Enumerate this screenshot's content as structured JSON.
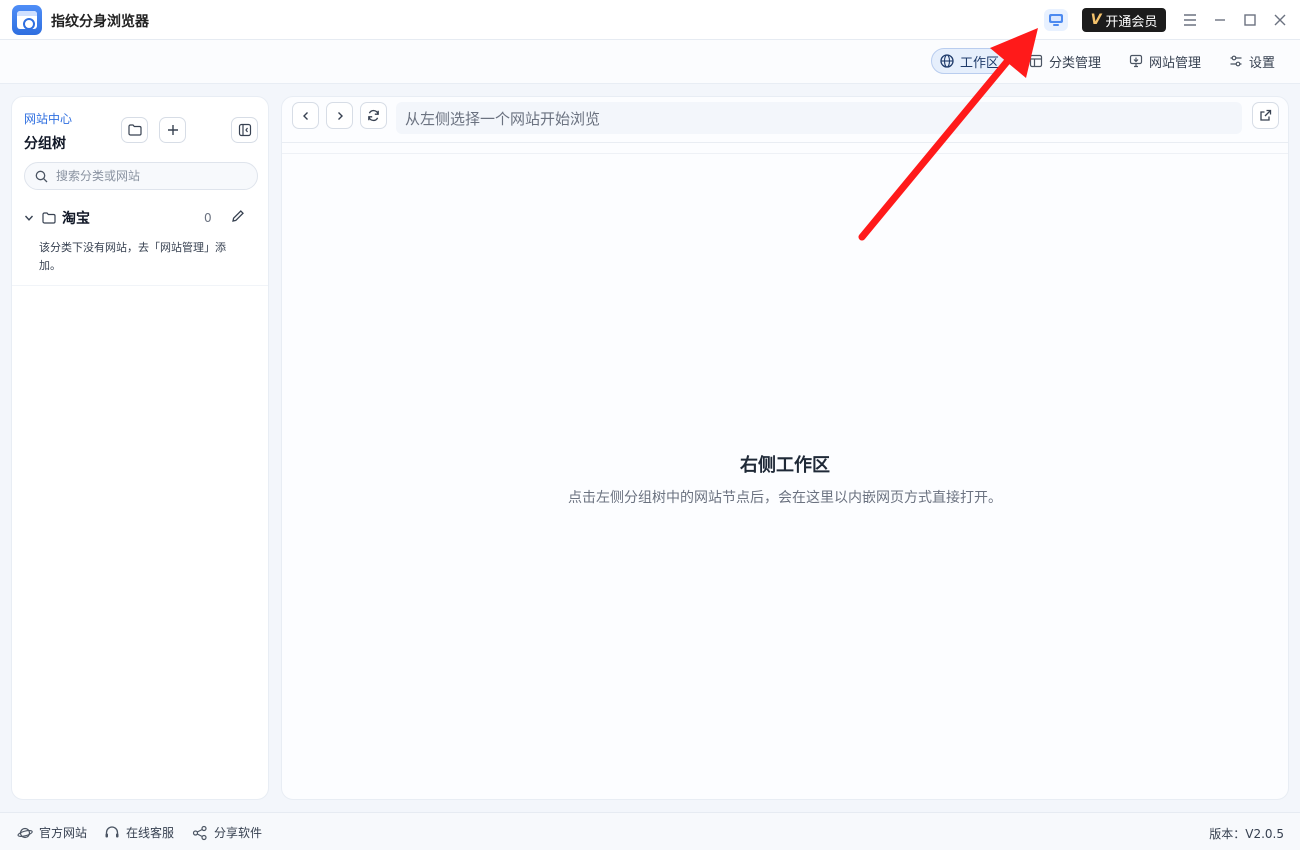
{
  "app": {
    "title": "指纹分身浏览器"
  },
  "titlebar": {
    "vip_label": "开通会员",
    "vip_mark": "V"
  },
  "nav": {
    "tabs": [
      {
        "label": "工作区",
        "icon": "globe-icon",
        "active": true
      },
      {
        "label": "分类管理",
        "icon": "layout-icon",
        "active": false
      },
      {
        "label": "网站管理",
        "icon": "monitor-icon",
        "active": false
      },
      {
        "label": "设置",
        "icon": "sliders-icon",
        "active": false
      }
    ]
  },
  "sidebar": {
    "subtitle": "网站中心",
    "title": "分组树",
    "search_placeholder": "搜索分类或网站",
    "tree": {
      "category_name": "淘宝",
      "count": "0",
      "empty_text": "该分类下没有网站，去「网站管理」添加。"
    }
  },
  "main": {
    "url_placeholder": "从左侧选择一个网站开始浏览",
    "empty_title": "右侧工作区",
    "empty_desc": "点击左侧分组树中的网站节点后，会在这里以内嵌网页方式直接打开。"
  },
  "footer": {
    "official_site": "官方网站",
    "online_support": "在线客服",
    "share_software": "分享软件",
    "version": "版本：V2.0.5"
  },
  "colors": {
    "accent": "#2f6fe0",
    "annotation": "#ff1a1a",
    "vip_bg": "#1c1c1c"
  }
}
